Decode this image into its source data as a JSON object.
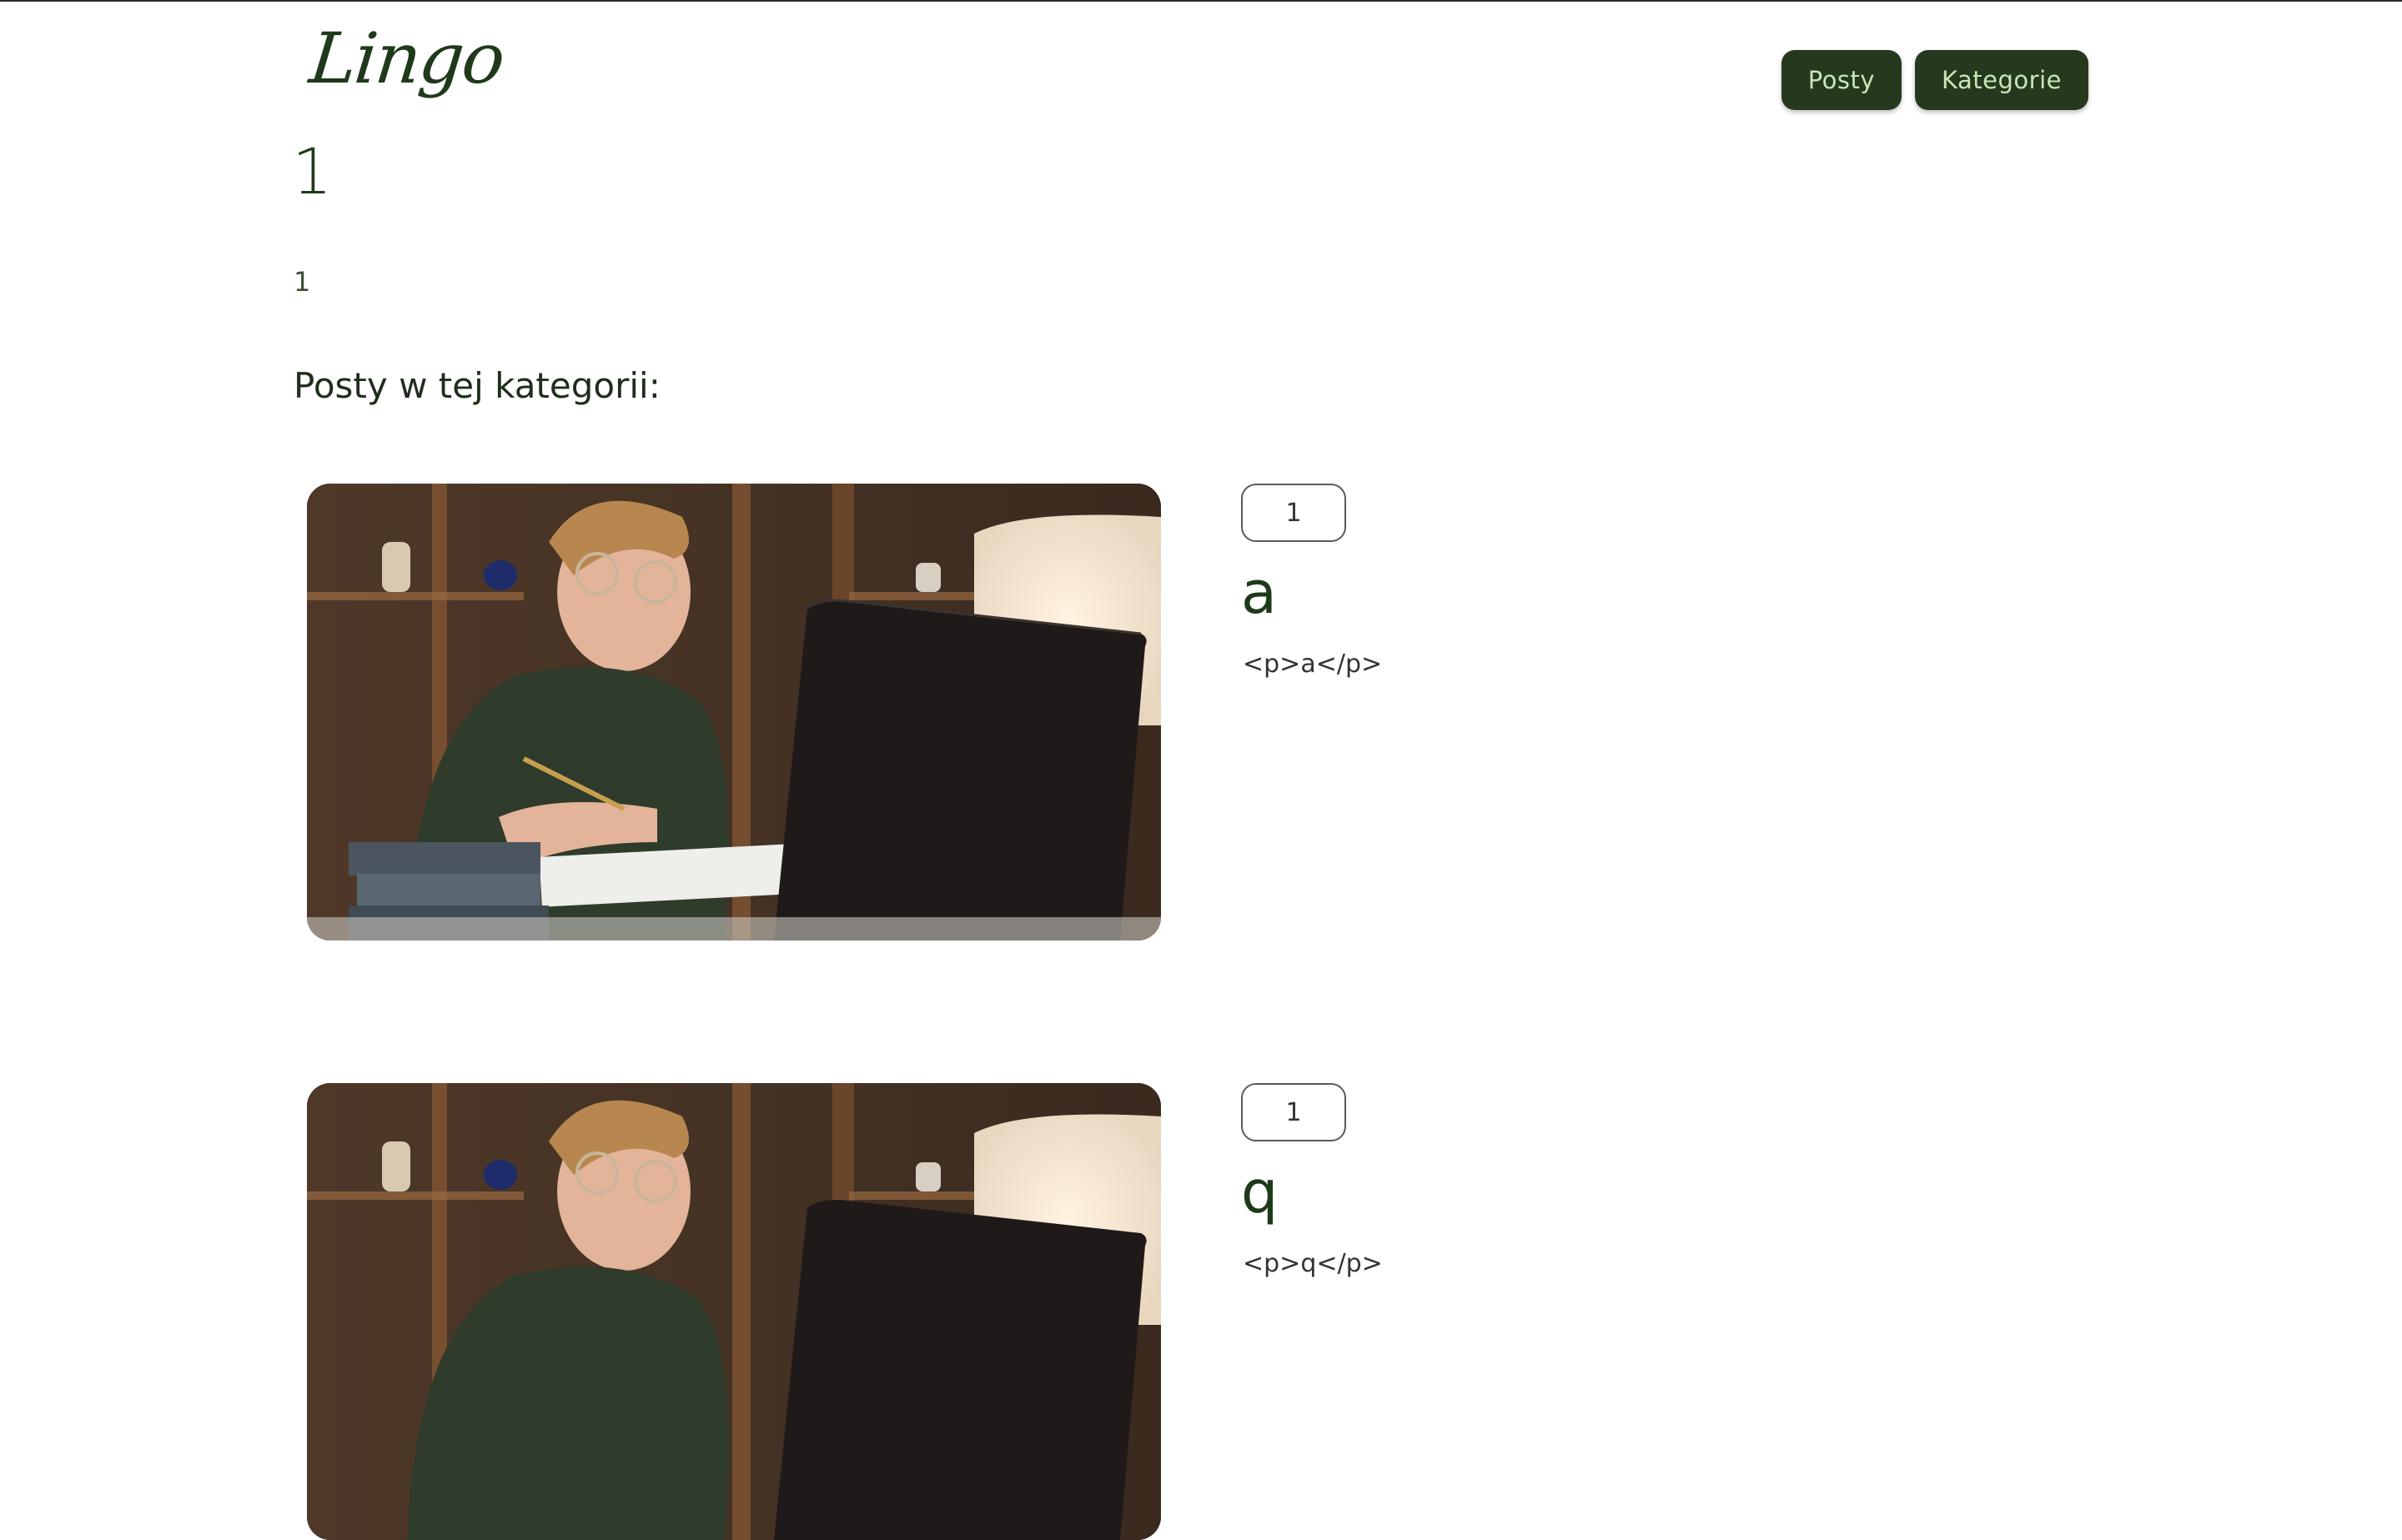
{
  "header": {
    "logo": "Lingo",
    "nav": [
      {
        "label": "Posty"
      },
      {
        "label": "Kategorie"
      }
    ]
  },
  "category": {
    "title": "1",
    "description": "1"
  },
  "section_heading": "Posty w tej kategorii:",
  "posts": [
    {
      "category_badge": "1",
      "title": "a",
      "excerpt": "<p>a</p>",
      "image": "man-with-glasses-at-laptop-photo"
    },
    {
      "category_badge": "1",
      "title": "q",
      "excerpt": "<p>q</p>",
      "image": "man-with-glasses-at-laptop-photo"
    }
  ],
  "colors": {
    "brand_dark_green": "#26391f",
    "nav_text": "#c9e7b5",
    "text_green": "#1f3a1a"
  }
}
